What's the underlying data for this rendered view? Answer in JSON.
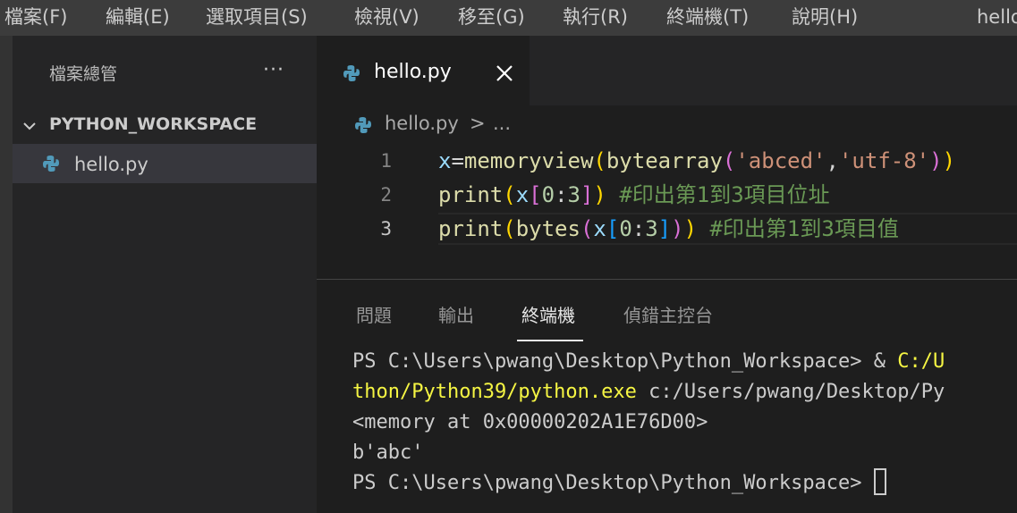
{
  "menubar": {
    "items": [
      "檔案(F)",
      "編輯(E)",
      "選取項目(S)",
      "檢視(V)",
      "移至(G)",
      "執行(R)",
      "終端機(T)",
      "說明(H)"
    ],
    "window_title": "hello"
  },
  "sidebar": {
    "title": "檔案總管",
    "more": "···",
    "folder": "PYTHON_WORKSPACE",
    "files": [
      "hello.py"
    ]
  },
  "tabs": [
    {
      "label": "hello.py",
      "close_icon": "close-icon"
    }
  ],
  "breadcrumb": {
    "file": "hello.py",
    "separator": ">",
    "more": "..."
  },
  "editor": {
    "lines": [
      {
        "number": "1",
        "text": "x=memoryview(bytearray('abced','utf-8'))"
      },
      {
        "number": "2",
        "text": "print(x[0:3]) #印出第1到3項目位址"
      },
      {
        "number": "3",
        "text": "print(bytes(x[0:3])) #印出第1到3項目值"
      }
    ],
    "active_line": 3
  },
  "panel": {
    "tabs": [
      "問題",
      "輸出",
      "終端機",
      "偵錯主控台"
    ],
    "active_tab": "終端機",
    "terminal": {
      "line1_prompt": "PS C:\\Users\\pwang\\Desktop\\Python_Workspace> & ",
      "line1_path": "C:/U",
      "line2_path": "thon/Python39/python.exe",
      "line2_arg": " c:/Users/pwang/Desktop/Py",
      "line3": "<memory at 0x00000202A1E76D00>",
      "line4": "b'abc'",
      "line5_prompt": "PS C:\\Users\\pwang\\Desktop\\Python_Workspace> "
    }
  },
  "colors": {
    "python_icon_blue": "#519aba",
    "string": "#ce9178",
    "comment": "#6a9955",
    "terminal_yellow": "#f5f543"
  }
}
